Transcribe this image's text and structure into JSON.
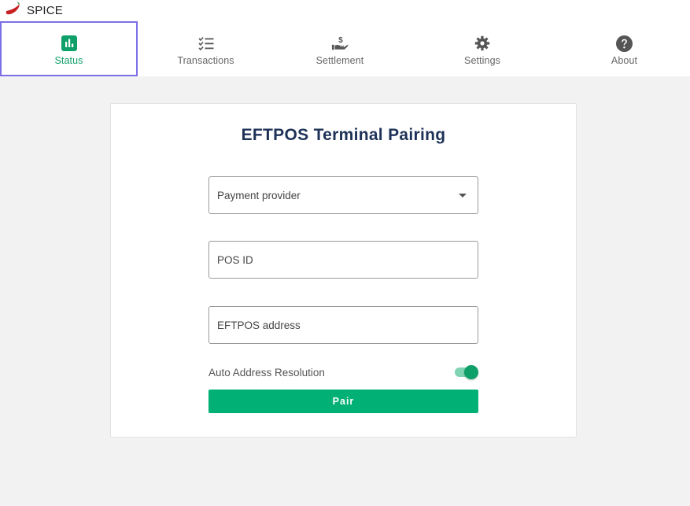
{
  "brand": {
    "name": "SPICE",
    "logo_icon": "chili-pepper-icon",
    "logo_color": "#c62020"
  },
  "nav": {
    "items": [
      {
        "label": "Status",
        "icon": "bar-chart-icon",
        "active": true
      },
      {
        "label": "Transactions",
        "icon": "checklist-icon",
        "active": false
      },
      {
        "label": "Settlement",
        "icon": "hand-dollar-icon",
        "active": false
      },
      {
        "label": "Settings",
        "icon": "gear-icon",
        "active": false
      },
      {
        "label": "About",
        "icon": "help-circle-icon",
        "active": false
      }
    ]
  },
  "pairing": {
    "title": "EFTPOS Terminal Pairing",
    "provider": {
      "value": "Payment provider",
      "icon": "caret-down-icon"
    },
    "pos_id": {
      "placeholder": "POS ID",
      "value": ""
    },
    "eftpos_address": {
      "placeholder": "EFTPOS address",
      "value": ""
    },
    "auto_address": {
      "label": "Auto Address Resolution",
      "enabled": true
    },
    "pair_button": "Pair"
  },
  "colors": {
    "accent": "#0fa06a",
    "button": "#00b074",
    "title": "#1e3157",
    "active_outline": "#7c6fe8",
    "background": "#f2f2f2"
  }
}
